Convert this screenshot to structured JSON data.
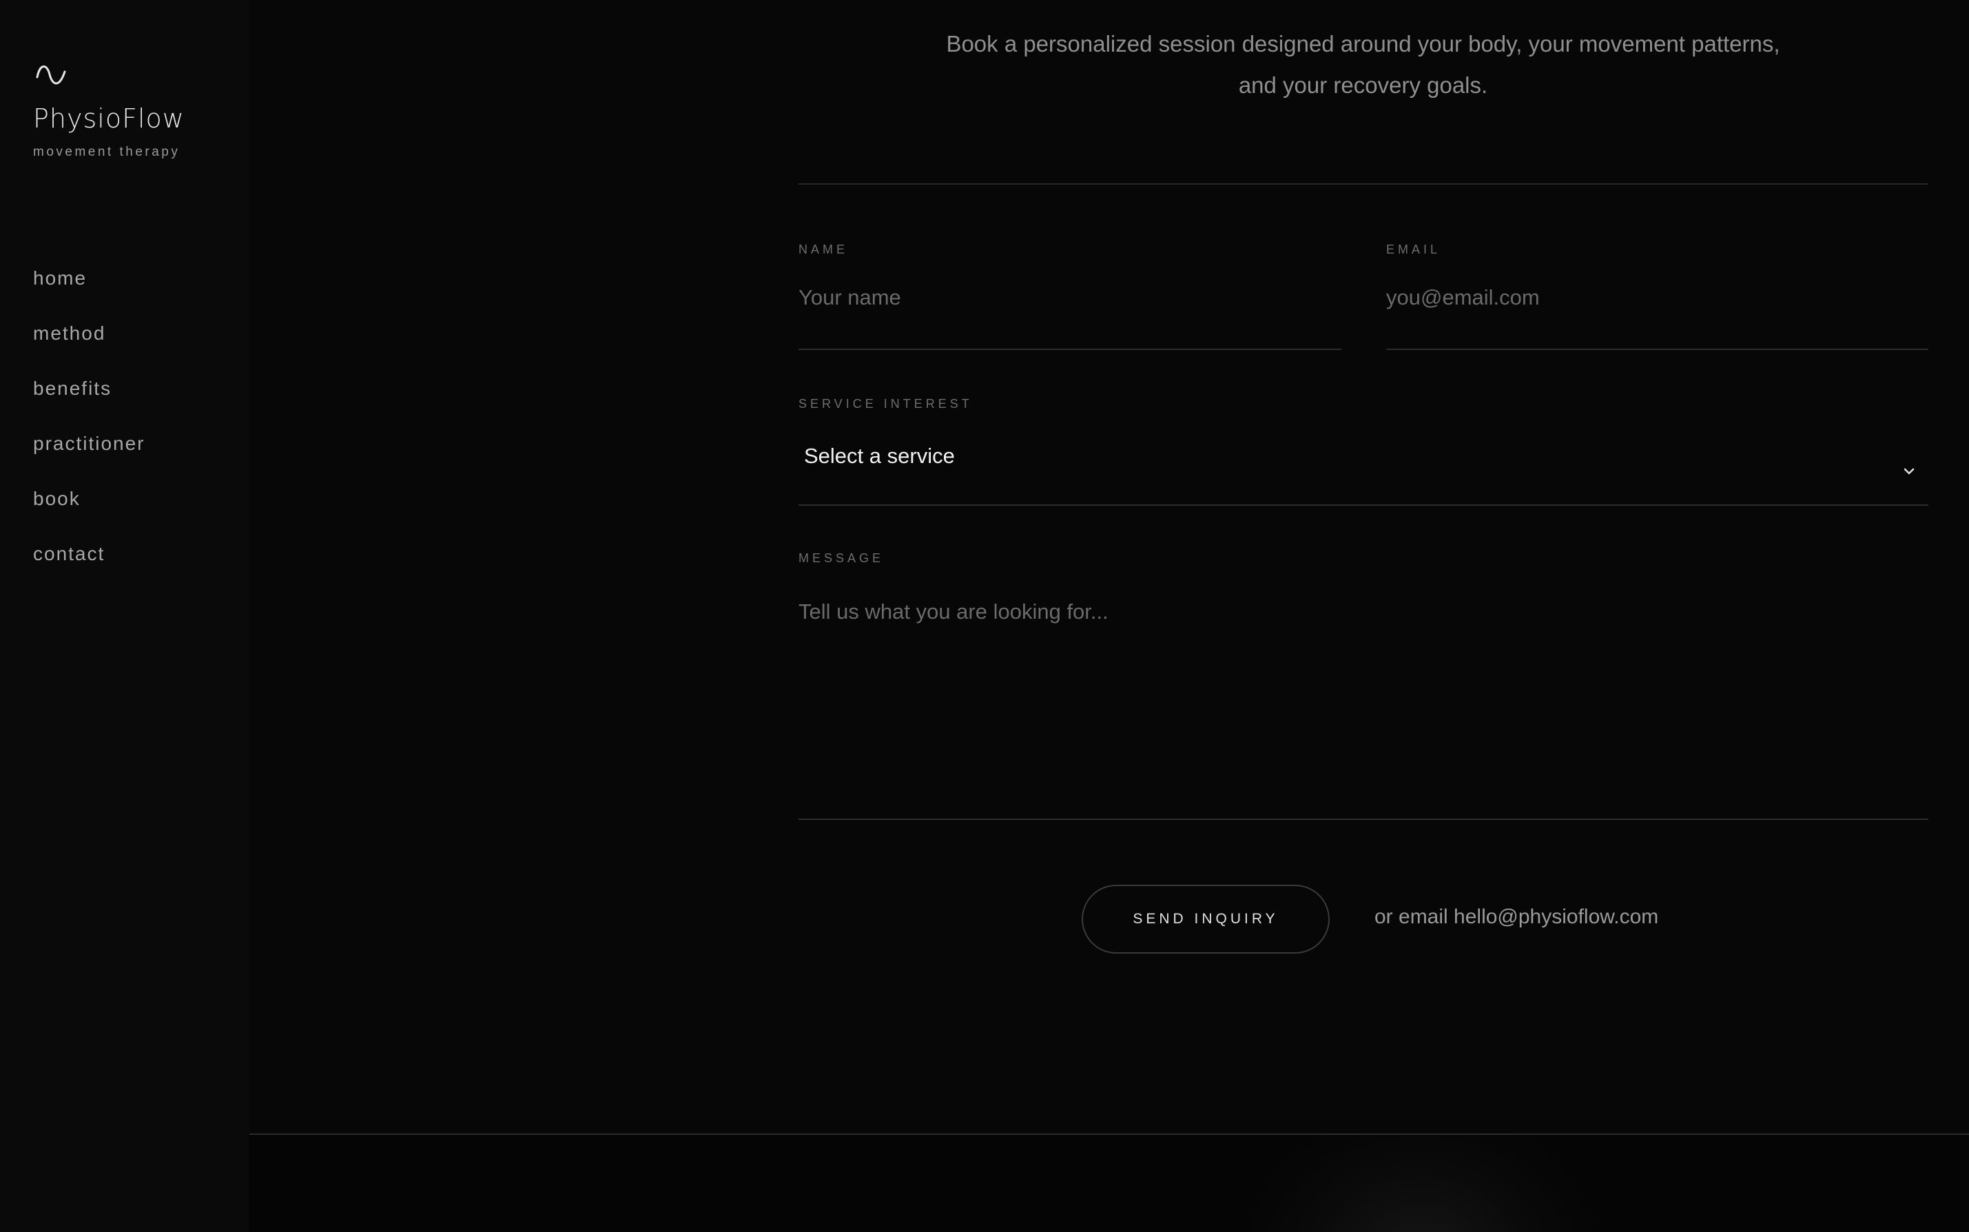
{
  "brand": {
    "logo_icon": "wave-icon",
    "name": "PhysioFlow",
    "tagline": "movement therapy"
  },
  "nav": {
    "items": [
      {
        "label": "home"
      },
      {
        "label": "method"
      },
      {
        "label": "benefits"
      },
      {
        "label": "practitioner"
      },
      {
        "label": "book"
      },
      {
        "label": "contact"
      }
    ]
  },
  "intro": {
    "text": "Book a personalized session designed around your body, your movement patterns, and your recovery goals."
  },
  "form": {
    "name": {
      "label": "NAME",
      "placeholder": "Your name",
      "value": ""
    },
    "email": {
      "label": "EMAIL",
      "placeholder": "you@email.com",
      "value": ""
    },
    "service": {
      "label": "SERVICE INTEREST",
      "selected": "Select a service",
      "icon": "chevron-down-icon"
    },
    "message": {
      "label": "MESSAGE",
      "placeholder": "Tell us what you are looking for...",
      "value": ""
    },
    "submit_label": "SEND INQUIRY",
    "alt_contact": "or email hello@physioflow.com"
  },
  "colors": {
    "background": "#080808",
    "sidebar": "#0a0a0a",
    "text": "#d8d8d8",
    "muted": "#8f8f8f",
    "divider": "#2c2c2c"
  }
}
